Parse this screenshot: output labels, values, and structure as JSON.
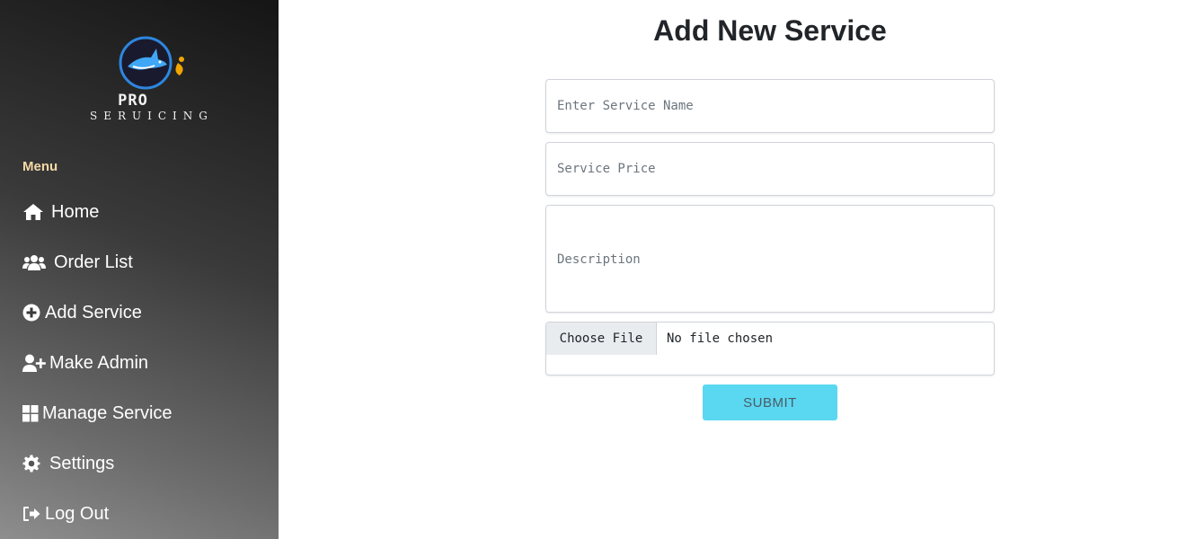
{
  "brand": {
    "line1": "PRO",
    "line2": "SERUICING"
  },
  "sidebar": {
    "menu_title": "Menu",
    "items": [
      {
        "label": "Home",
        "icon": "home-icon"
      },
      {
        "label": "Order List",
        "icon": "users-icon"
      },
      {
        "label": "Add Service",
        "icon": "plus-circle-icon"
      },
      {
        "label": "Make Admin",
        "icon": "user-plus-icon"
      },
      {
        "label": "Manage Service",
        "icon": "grid-icon"
      },
      {
        "label": "Settings",
        "icon": "gear-icon"
      },
      {
        "label": "Log Out",
        "icon": "sign-out-icon"
      }
    ]
  },
  "form": {
    "title": "Add New Service",
    "name_placeholder": "Enter Service Name",
    "price_placeholder": "Service Price",
    "description_placeholder": "Description",
    "choose_file_label": "Choose File",
    "file_status": "No file chosen",
    "submit_label": "SUBMIT"
  },
  "colors": {
    "menu_title": "#f4d9a6",
    "submit_bg": "#5bd8f1",
    "sidebar_dark": "#151515",
    "sidebar_light": "#8e8e8e"
  }
}
